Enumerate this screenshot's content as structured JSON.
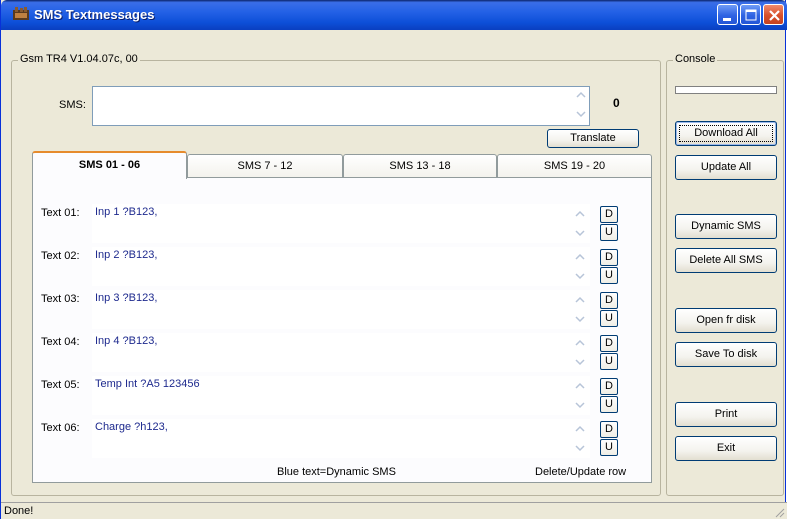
{
  "window": {
    "title": "SMS Textmessages",
    "minimize_icon": "minimize-icon",
    "maximize_icon": "maximize-icon",
    "close_icon": "close-icon"
  },
  "main_group": {
    "legend": "Gsm TR4 V1.04.07c, 00",
    "sms_label": "SMS:",
    "sms_value": "",
    "char_count": "0",
    "translate_label": "Translate"
  },
  "tabs": [
    {
      "label": "SMS 01 - 06",
      "active": true
    },
    {
      "label": "SMS 7 - 12",
      "active": false
    },
    {
      "label": "SMS 13 - 18",
      "active": false
    },
    {
      "label": "SMS 19 - 20",
      "active": false
    }
  ],
  "rows": [
    {
      "label": "Text 01:",
      "value": "Inp 1 ?B123,"
    },
    {
      "label": "Text 02:",
      "value": "Inp 2 ?B123,"
    },
    {
      "label": "Text 03:",
      "value": "Inp 3 ?B123,"
    },
    {
      "label": "Text 04:",
      "value": "Inp 4 ?B123,"
    },
    {
      "label": "Text 05:",
      "value": "Temp Int ?A5 123456"
    },
    {
      "label": "Text 06:",
      "value": "Charge ?h123,"
    }
  ],
  "row_buttons": {
    "download": "D",
    "update": "U"
  },
  "footer": {
    "legend_note": "Blue text=Dynamic SMS",
    "row_note": "Delete/Update row"
  },
  "console": {
    "legend": "Console",
    "buttons": {
      "download_all": "Download All",
      "update_all": "Update All",
      "dynamic_sms": "Dynamic SMS",
      "delete_all": "Delete All SMS",
      "open_disk": "Open fr disk",
      "save_disk": "Save To disk",
      "print": "Print",
      "exit": "Exit"
    }
  },
  "status": {
    "text": "Done!"
  },
  "colors": {
    "dynamic_text": "#1E2A8E",
    "titlebar": "#2361E6",
    "tab_accent": "#E68B2C"
  }
}
